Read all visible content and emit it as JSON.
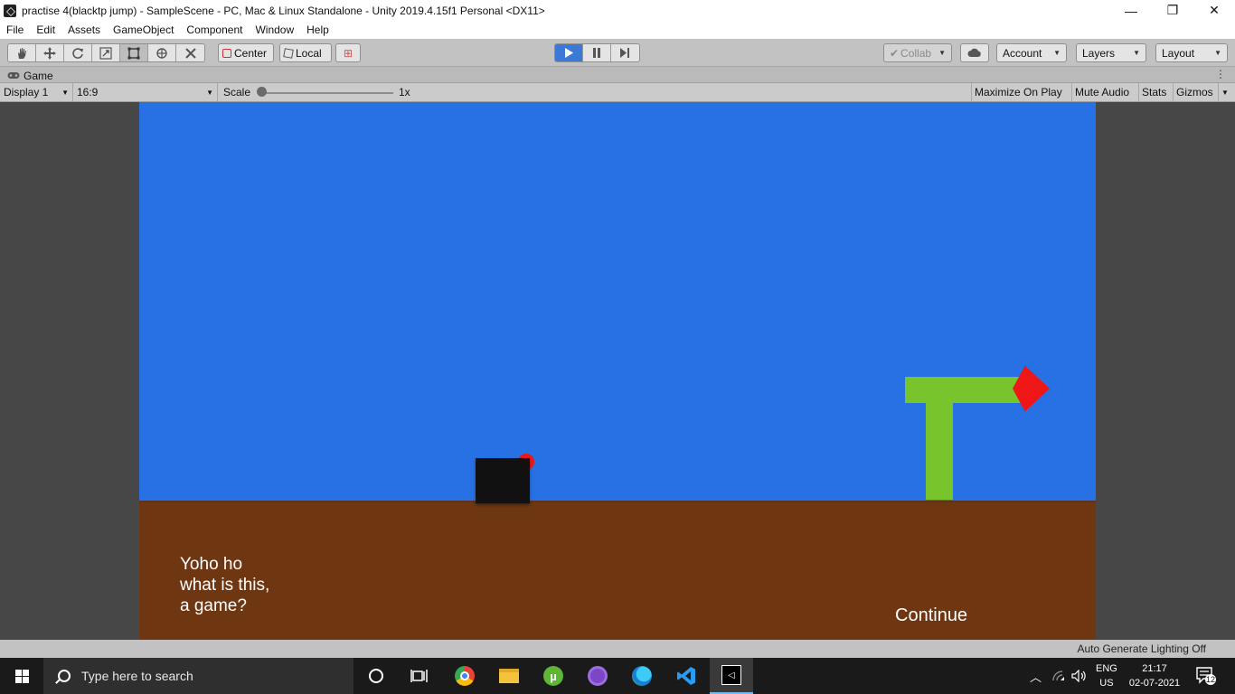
{
  "window": {
    "title": "practise 4(blacktp jump) - SampleScene - PC, Mac & Linux Standalone - Unity 2019.4.15f1 Personal <DX11>",
    "minimize_glyph": "—",
    "restore_glyph": "❐",
    "close_glyph": "✕"
  },
  "menu": [
    "File",
    "Edit",
    "Assets",
    "GameObject",
    "Component",
    "Window",
    "Help"
  ],
  "toolbar": {
    "pivot_center": "Center",
    "pivot_local": "Local",
    "collab": "Collab",
    "account": "Account",
    "layers": "Layers",
    "layout": "Layout"
  },
  "tab": {
    "label": "Game"
  },
  "game_toolbar": {
    "display": "Display 1",
    "aspect": "16:9",
    "scale_label": "Scale",
    "scale_value": "1x",
    "maximize": "Maximize On Play",
    "mute": "Mute Audio",
    "stats": "Stats",
    "gizmos": "Gizmos"
  },
  "game": {
    "dialog_lines": [
      "Yoho ho",
      "what is this,",
      "a game?"
    ],
    "continue_label": "Continue",
    "colors": {
      "sky": "#2871e4",
      "ground": "#6f3612",
      "player": "#111111",
      "sign": "#78c42c",
      "arrow": "#ee1616"
    }
  },
  "status": {
    "lighting": "Auto Generate Lighting Off"
  },
  "taskbar": {
    "search_placeholder": "Type here to search",
    "lang_line1": "ENG",
    "lang_line2": "US",
    "time": "21:17",
    "date": "02-07-2021",
    "notification_count": "12"
  }
}
